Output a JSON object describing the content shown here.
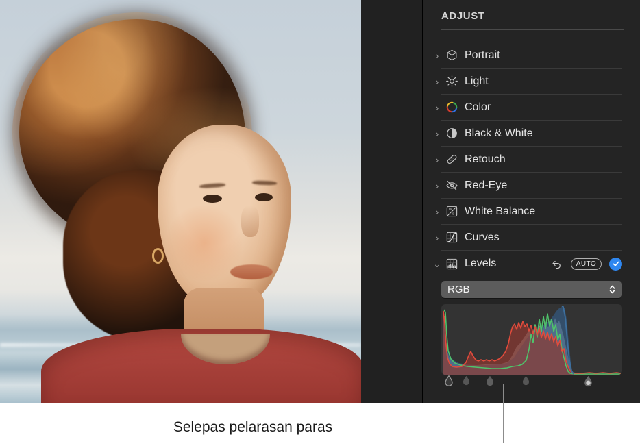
{
  "panel": {
    "title": "ADJUST",
    "rows": [
      {
        "label": "Portrait",
        "icon": "cube-icon",
        "expanded": false
      },
      {
        "label": "Light",
        "icon": "sun-icon",
        "expanded": false
      },
      {
        "label": "Color",
        "icon": "color-wheel-icon",
        "expanded": false
      },
      {
        "label": "Black & White",
        "icon": "half-circle-icon",
        "expanded": false
      },
      {
        "label": "Retouch",
        "icon": "bandage-icon",
        "expanded": false
      },
      {
        "label": "Red-Eye",
        "icon": "eye-slash-icon",
        "expanded": false
      },
      {
        "label": "White Balance",
        "icon": "white-balance-icon",
        "expanded": false
      },
      {
        "label": "Curves",
        "icon": "curves-icon",
        "expanded": false
      },
      {
        "label": "Levels",
        "icon": "levels-icon",
        "expanded": true
      }
    ],
    "levels": {
      "reset_icon": "undo-arrow-icon",
      "auto_label": "AUTO",
      "applied_icon": "checkmark-icon",
      "channel_selected": "RGB",
      "stepper_icon": "up-down-chevron-icon",
      "handles": [
        {
          "name": "black-point",
          "position_pct": 4,
          "style": "outline"
        },
        {
          "name": "shadows",
          "position_pct": 14,
          "style": "filled"
        },
        {
          "name": "midtones",
          "position_pct": 27,
          "style": "filled"
        },
        {
          "name": "highlights",
          "position_pct": 47,
          "style": "filled"
        },
        {
          "name": "white-point",
          "position_pct": 81,
          "style": "light"
        }
      ]
    }
  },
  "photo": {
    "alt": "portrait-of-person-with-curly-hair-at-beach"
  },
  "callout": {
    "caption": "Selepas pelarasan paras"
  },
  "colors": {
    "accent": "#2f87f0",
    "panel_bg": "#242424",
    "histogram_bg": "#333333",
    "red_channel": "#e14b3c",
    "green_channel": "#4fc46b",
    "blue_channel": "#3d6f9e",
    "text": "#e6e6e6"
  }
}
